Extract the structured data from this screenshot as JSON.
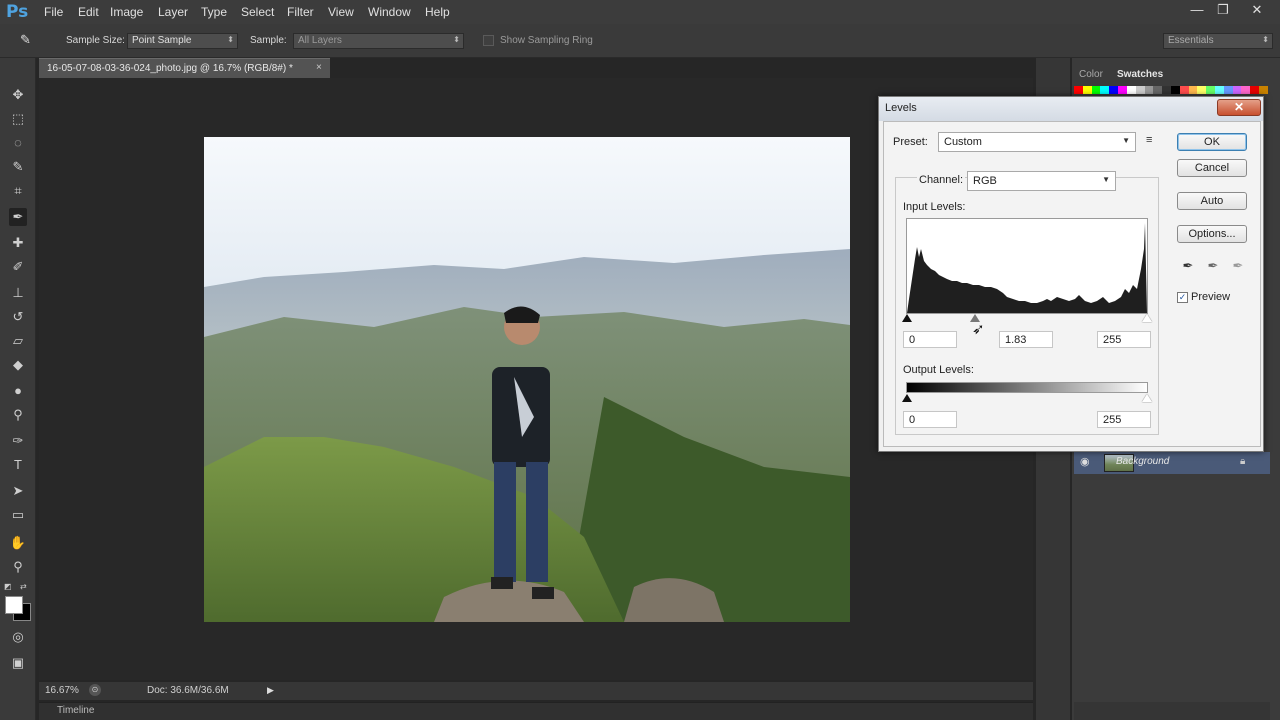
{
  "app": {
    "logo": "Ps",
    "menu": [
      "File",
      "Edit",
      "Image",
      "Layer",
      "Type",
      "Select",
      "Filter",
      "View",
      "Window",
      "Help"
    ],
    "window_controls": [
      "—",
      "❐",
      "✕"
    ]
  },
  "options_bar": {
    "sample_size_label": "Sample Size:",
    "sample_size_value": "Point Sample",
    "sample_label": "Sample:",
    "sample_value": "All Layers",
    "show_sampling_ring": "Show Sampling Ring",
    "workspace": "Essentials"
  },
  "document": {
    "tab_title": "16-05-07-08-03-36-024_photo.jpg @ 16.7% (RGB/8#) *",
    "close": "×"
  },
  "status": {
    "zoom": "16.67%",
    "doc_size": "Doc: 36.6M/36.6M",
    "timeline": "Timeline"
  },
  "panels": {
    "tabs": [
      "Color",
      "Swatches"
    ],
    "layer_name": "Background",
    "swatch_colors": [
      "#ff0000",
      "#ffff00",
      "#00ff00",
      "#00ffff",
      "#0000ff",
      "#ff00ff",
      "#ffffff",
      "#cccccc",
      "#999999",
      "#666666",
      "#333333",
      "#000000",
      "#ff4d4d",
      "#ffb84d",
      "#ffff66",
      "#66ff66",
      "#66ffff",
      "#6699ff",
      "#cc66ff",
      "#ff66cc",
      "#e60000",
      "#c88200"
    ]
  },
  "levels": {
    "title": "Levels",
    "close": "✕",
    "preset_label": "Preset:",
    "preset_value": "Custom",
    "channel_label": "Channel:",
    "channel_value": "RGB",
    "input_levels_label": "Input Levels:",
    "input_black": "0",
    "input_gamma": "1.83",
    "input_white": "255",
    "output_levels_label": "Output Levels:",
    "output_black": "0",
    "output_white": "255",
    "buttons": {
      "ok": "OK",
      "cancel": "Cancel",
      "auto": "Auto",
      "options": "Options..."
    },
    "preview_label": "Preview",
    "preview_checked": true
  }
}
